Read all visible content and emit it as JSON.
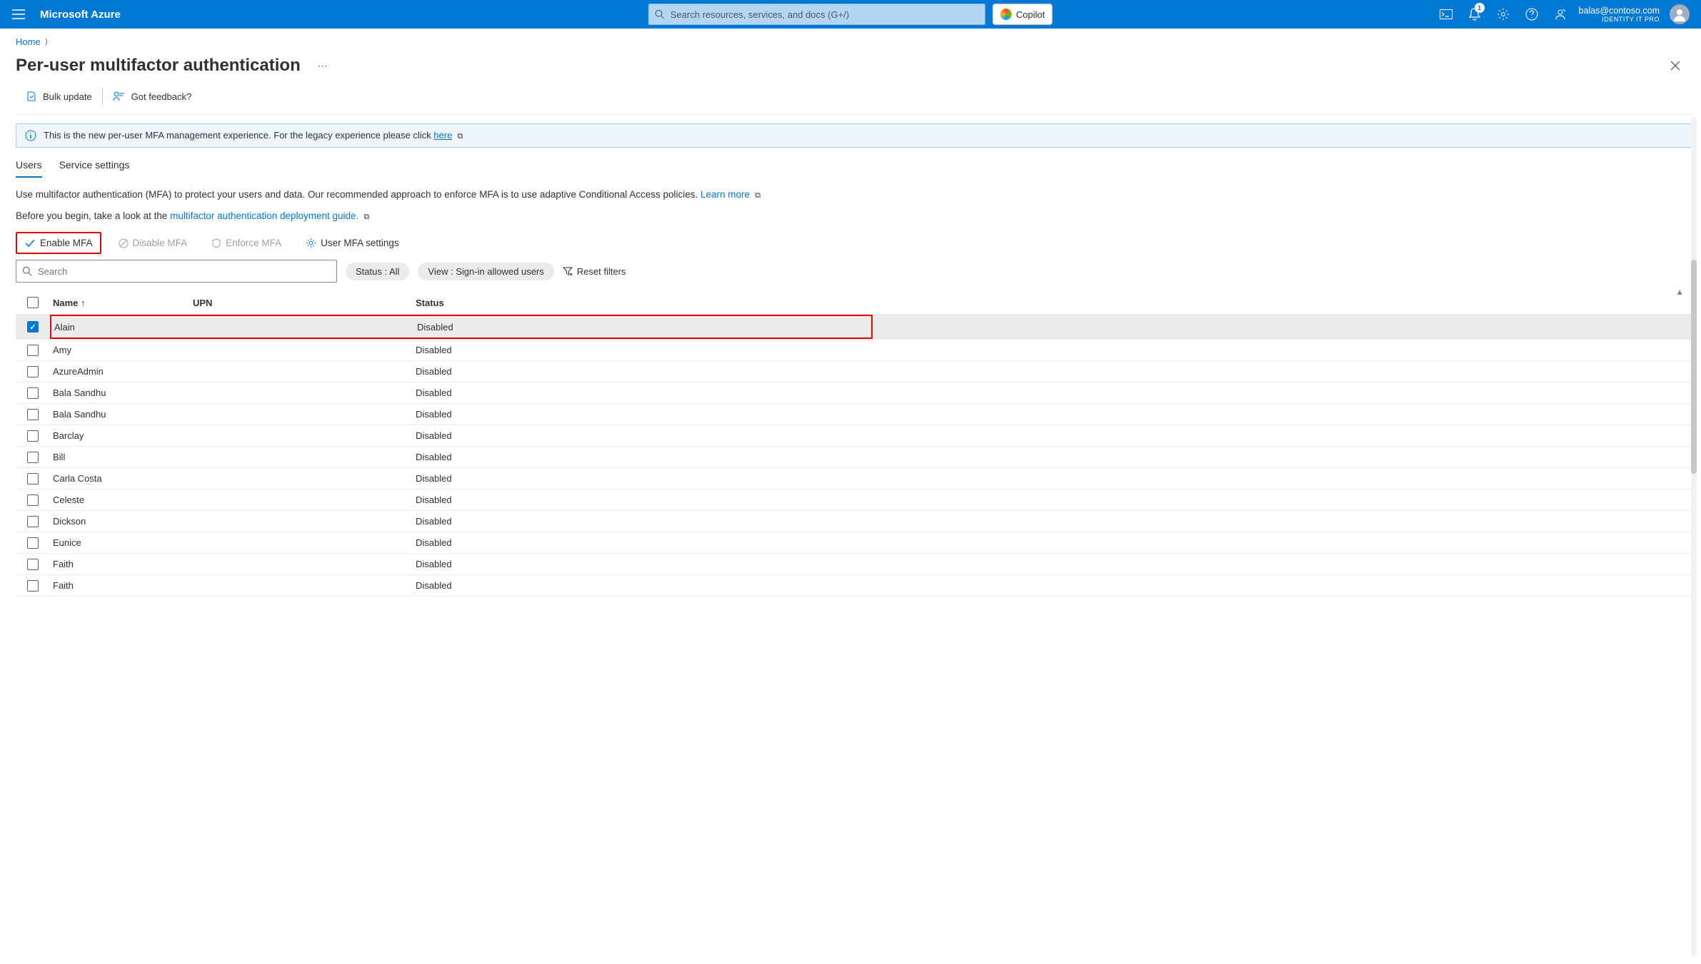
{
  "header": {
    "brand": "Microsoft Azure",
    "search_placeholder": "Search resources, services, and docs (G+/)",
    "copilot_label": "Copilot",
    "notif_badge": "1",
    "account_email": "balas@contoso.com",
    "account_role": "IDENTITY IT PRO"
  },
  "breadcrumb": {
    "home": "Home"
  },
  "page": {
    "title": "Per-user multifactor authentication"
  },
  "cmdbar": {
    "bulk_update": "Bulk update",
    "feedback": "Got feedback?"
  },
  "banner": {
    "text_prefix": "This is the new per-user MFA management experience. For the legacy experience please click ",
    "link": "here"
  },
  "tabs": {
    "users": "Users",
    "service": "Service settings"
  },
  "desc": {
    "line1_prefix": "Use multifactor authentication (MFA) to protect your users and data. Our recommended approach to enforce MFA is to use adaptive Conditional Access policies. ",
    "learn_more": "Learn more",
    "line2_prefix": "Before you begin, take a look at the ",
    "guide_link": "multifactor authentication deployment guide."
  },
  "mfa": {
    "enable": "Enable MFA",
    "disable": "Disable MFA",
    "enforce": "Enforce MFA",
    "settings": "User MFA settings"
  },
  "filters": {
    "search_placeholder": "Search",
    "status_pill": "Status : All",
    "view_pill": "View : Sign-in allowed users",
    "reset": "Reset filters"
  },
  "table": {
    "col_name": "Name",
    "sort_arrow": "↑",
    "col_upn": "UPN",
    "col_status": "Status",
    "rows": [
      {
        "name": "Alain",
        "upn": "",
        "status": "Disabled",
        "checked": true,
        "highlighted": true
      },
      {
        "name": "Amy",
        "upn": "",
        "status": "Disabled",
        "checked": false,
        "highlighted": false
      },
      {
        "name": "AzureAdmin",
        "upn": "",
        "status": "Disabled",
        "checked": false,
        "highlighted": false
      },
      {
        "name": "Bala Sandhu",
        "upn": "",
        "status": "Disabled",
        "checked": false,
        "highlighted": false
      },
      {
        "name": "Bala Sandhu",
        "upn": "",
        "status": "Disabled",
        "checked": false,
        "highlighted": false
      },
      {
        "name": "Barclay",
        "upn": "",
        "status": "Disabled",
        "checked": false,
        "highlighted": false
      },
      {
        "name": "Bill",
        "upn": "",
        "status": "Disabled",
        "checked": false,
        "highlighted": false
      },
      {
        "name": "Carla Costa",
        "upn": "",
        "status": "Disabled",
        "checked": false,
        "highlighted": false
      },
      {
        "name": "Celeste",
        "upn": "",
        "status": "Disabled",
        "checked": false,
        "highlighted": false
      },
      {
        "name": "Dickson",
        "upn": "",
        "status": "Disabled",
        "checked": false,
        "highlighted": false
      },
      {
        "name": "Eunice",
        "upn": "",
        "status": "Disabled",
        "checked": false,
        "highlighted": false
      },
      {
        "name": "Faith",
        "upn": "",
        "status": "Disabled",
        "checked": false,
        "highlighted": false
      },
      {
        "name": "Faith",
        "upn": "",
        "status": "Disabled",
        "checked": false,
        "highlighted": false
      }
    ]
  }
}
